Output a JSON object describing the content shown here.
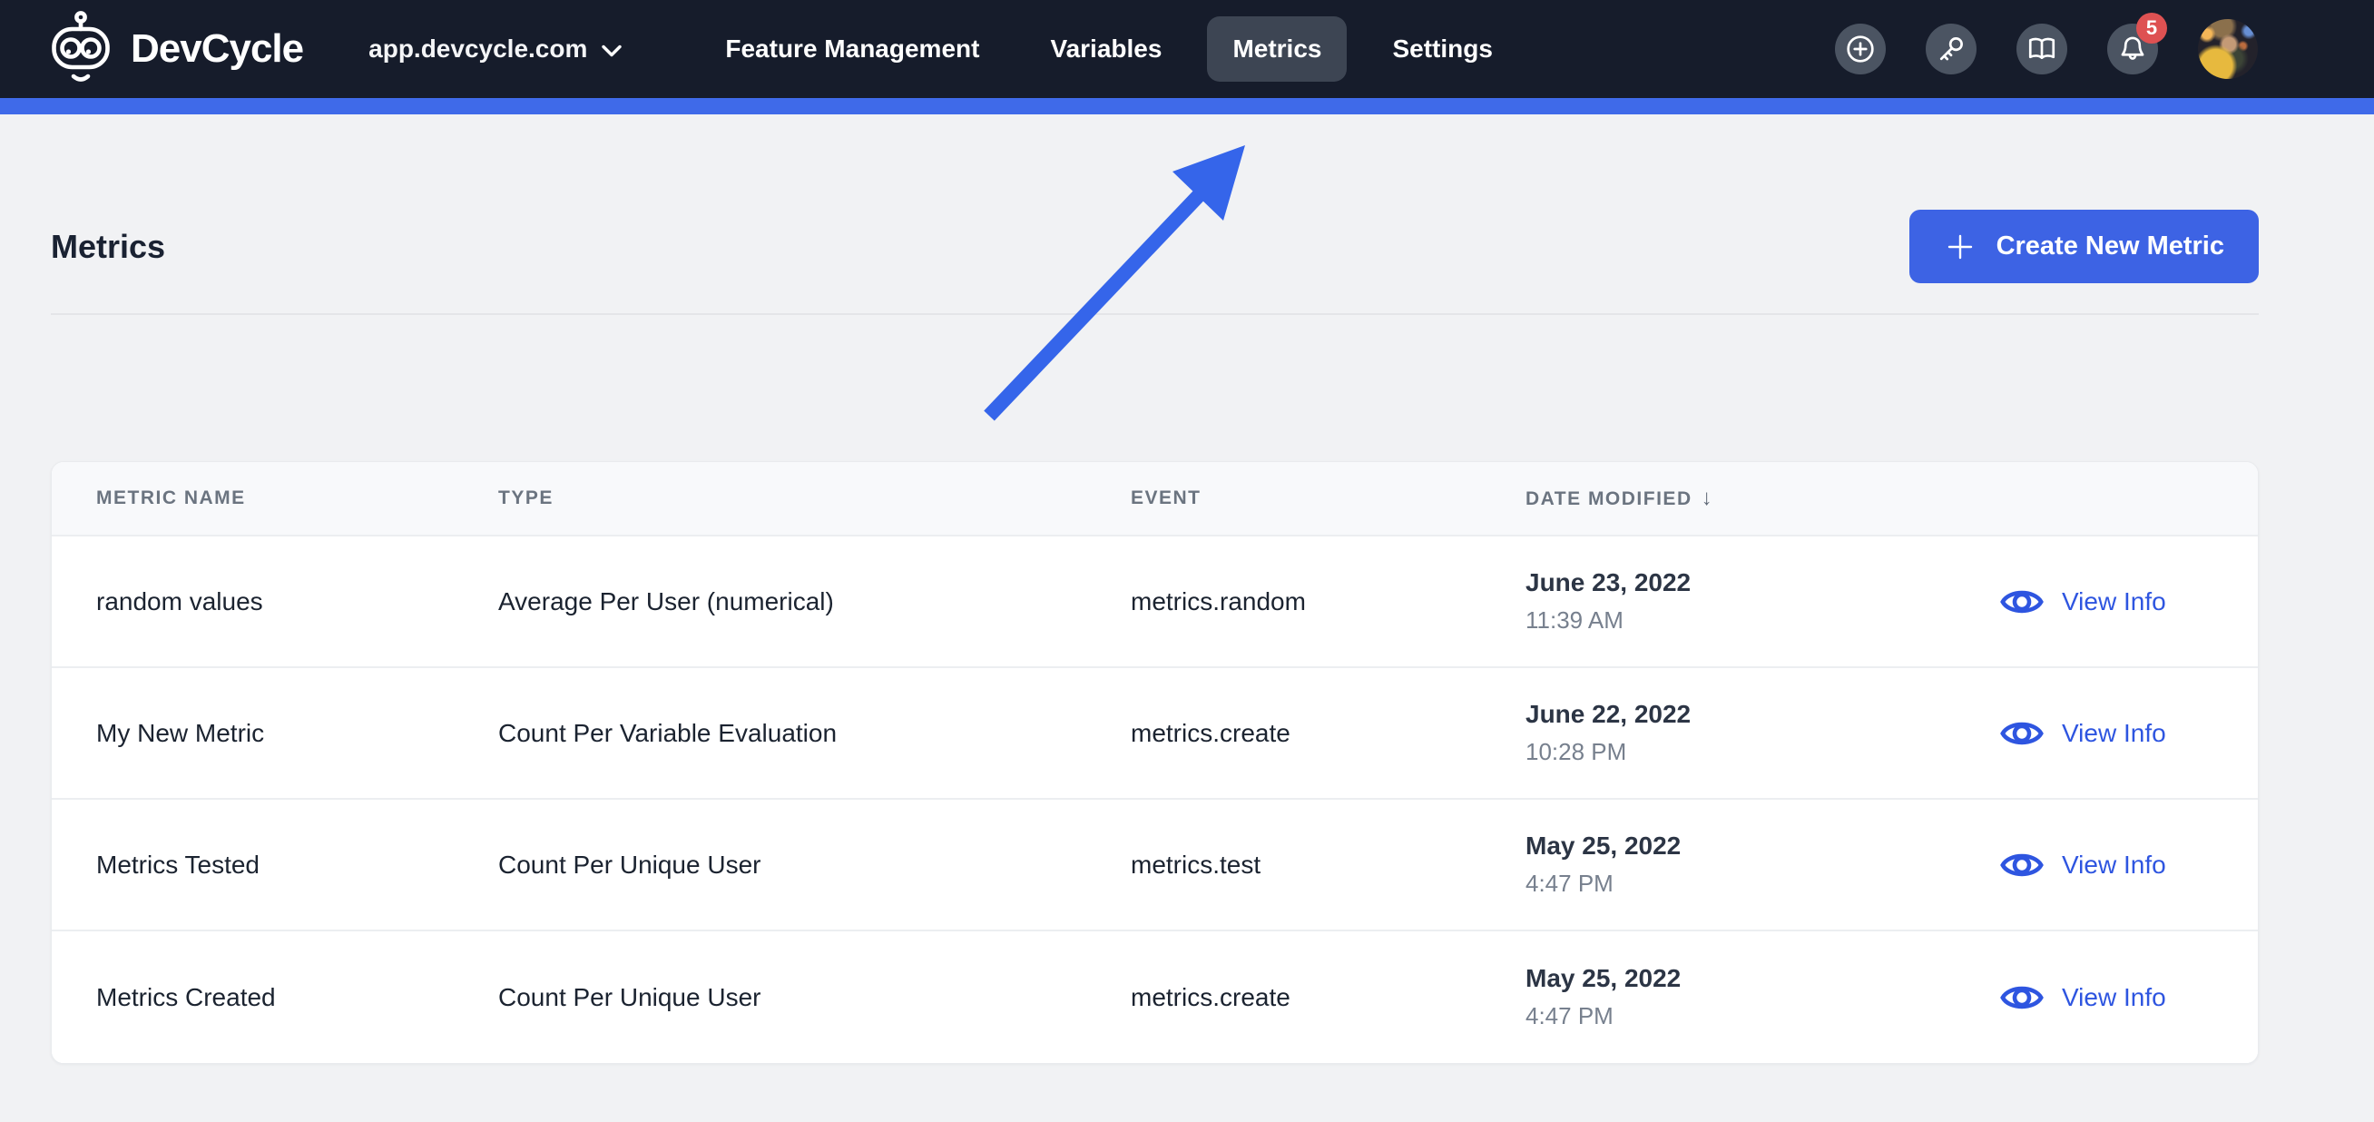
{
  "navbar": {
    "brand": "DevCycle",
    "org_selector": {
      "label": "app.devcycle.com"
    },
    "links": [
      {
        "label": "Feature Management",
        "active": false
      },
      {
        "label": "Variables",
        "active": false
      },
      {
        "label": "Metrics",
        "active": true
      },
      {
        "label": "Settings",
        "active": false
      }
    ],
    "notification_badge": "5"
  },
  "page": {
    "title": "Metrics",
    "create_button_label": "Create New Metric"
  },
  "table": {
    "headers": {
      "name": "METRIC NAME",
      "type": "TYPE",
      "event": "EVENT",
      "date": "DATE MODIFIED",
      "sort_glyph": "↓"
    },
    "action_label": "View Info",
    "rows": [
      {
        "name": "random values",
        "type": "Average Per User (numerical)",
        "event": "metrics.random",
        "date": "June 23, 2022",
        "time": "11:39 AM"
      },
      {
        "name": "My New Metric",
        "type": "Count Per Variable Evaluation",
        "event": "metrics.create",
        "date": "June 22, 2022",
        "time": "10:28 PM"
      },
      {
        "name": "Metrics Tested",
        "type": "Count Per Unique User",
        "event": "metrics.test",
        "date": "May 25, 2022",
        "time": "4:47 PM"
      },
      {
        "name": "Metrics Created",
        "type": "Count Per Unique User",
        "event": "metrics.create",
        "date": "May 25, 2022",
        "time": "4:47 PM"
      }
    ]
  },
  "colors": {
    "navbar_bg": "#161c2b",
    "accent_bar_blue": "#3f6ae9",
    "button_blue": "#3d63e4",
    "link_blue": "#2e55e0",
    "annotation_arrow_blue": "#3565ea",
    "badge_red": "#de5152",
    "page_bg": "#f1f2f4"
  }
}
